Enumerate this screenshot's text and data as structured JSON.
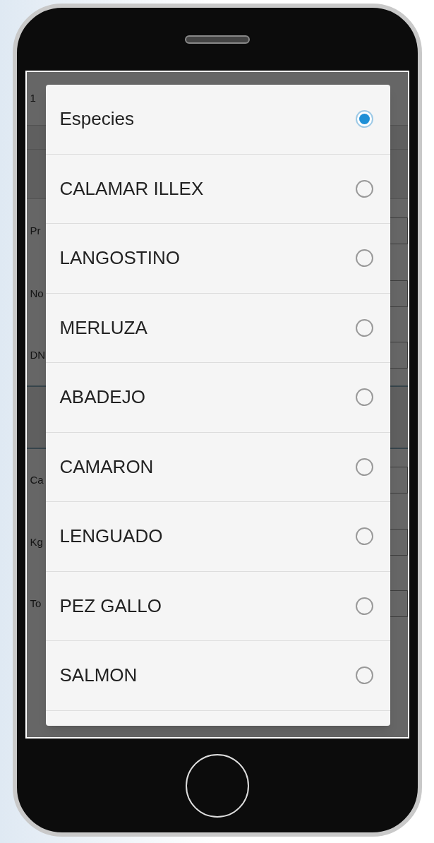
{
  "background_form": {
    "labels": [
      "1",
      "Pr",
      "No",
      "DN",
      "Ca",
      "Kg",
      "To"
    ]
  },
  "dialog": {
    "options": [
      {
        "label": "Especies",
        "selected": true
      },
      {
        "label": "CALAMAR ILLEX",
        "selected": false
      },
      {
        "label": "LANGOSTINO",
        "selected": false
      },
      {
        "label": "MERLUZA",
        "selected": false
      },
      {
        "label": "ABADEJO",
        "selected": false
      },
      {
        "label": "CAMARON",
        "selected": false
      },
      {
        "label": "LENGUADO",
        "selected": false
      },
      {
        "label": "PEZ GALLO",
        "selected": false
      },
      {
        "label": "SALMON",
        "selected": false
      }
    ]
  }
}
